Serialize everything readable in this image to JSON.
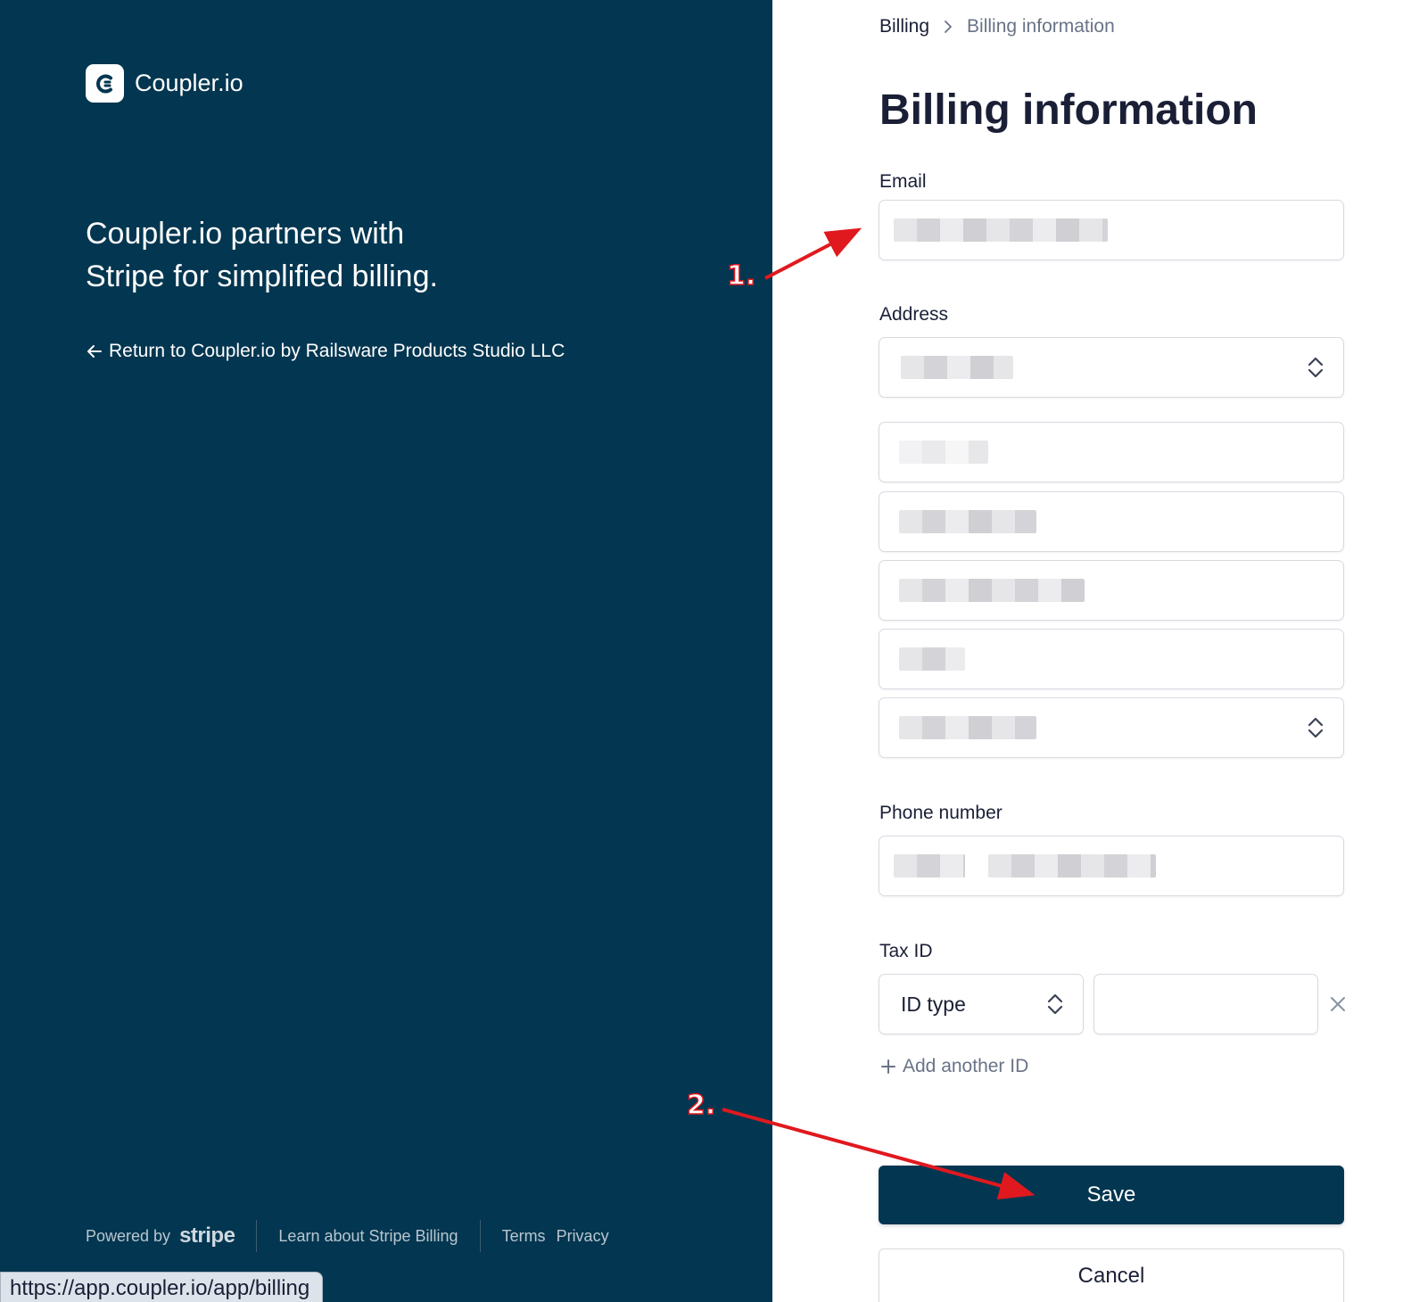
{
  "left_panel": {
    "brand_name": "Coupler.io",
    "headline_line1": "Coupler.io partners with",
    "headline_line2": "Stripe for simplified billing.",
    "return_link": "Return to Coupler.io by Railsware Products Studio LLC",
    "footer": {
      "powered_by": "Powered by",
      "stripe_word": "stripe",
      "learn_link": "Learn about Stripe Billing",
      "terms_link": "Terms",
      "privacy_link": "Privacy"
    },
    "status_url": "https://app.coupler.io/app/billing",
    "background_color": "#033650"
  },
  "breadcrumb": {
    "root": "Billing",
    "current": "Billing information"
  },
  "page_title": "Billing information",
  "form": {
    "email_label": "Email",
    "address_label": "Address",
    "phone_label": "Phone number",
    "tax_label": "Tax ID",
    "id_type_placeholder": "ID type",
    "add_another_id": "Add another ID",
    "save_label": "Save",
    "cancel_label": "Cancel"
  },
  "annotations": {
    "step1": "1.",
    "step2": "2.",
    "color": "#e0191f"
  }
}
